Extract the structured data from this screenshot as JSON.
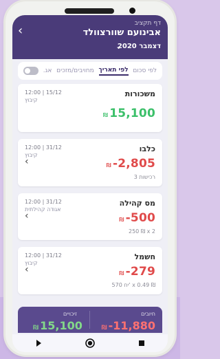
{
  "header": {
    "small": "דף תקציב",
    "title": "אבינועם שוורצוולד",
    "month": "דצמבר 2020",
    "back_icon": "chevron-left"
  },
  "tabs": {
    "items": [
      "לפי סכום",
      "לפי תאריך",
      "מחויבים/מזכים",
      "אג."
    ],
    "active_index": 1
  },
  "cards": [
    {
      "title": "משכורות",
      "time": "12:00 | 15/12",
      "sub": "קיבוץ",
      "amount_value": "15,100",
      "amount_currency": "₪",
      "amount_color": "#3cc06a",
      "extra": ""
    },
    {
      "title": "כלבו",
      "time": "12:00 | 31/12",
      "sub": "קיבוץ",
      "amount_value": "-2,805",
      "amount_currency": "₪",
      "amount_color": "#e04b4b",
      "extra": "3 רכישות"
    },
    {
      "title": "מס קהילה",
      "time": "12:00 | 31/12",
      "sub": "אגודה קהילתית",
      "amount_value": "-500",
      "amount_currency": "₪",
      "amount_color": "#e04b4b",
      "extra": "250 ₪ x 2"
    },
    {
      "title": "חשמל",
      "time": "12:00 | 31/12",
      "sub": "קיבוץ",
      "amount_value": "-279",
      "amount_currency": "₪",
      "amount_color": "#e04b4b",
      "extra": "570 יח' x 0.49 ₪"
    }
  ],
  "summary": {
    "left_label": "זיכויים",
    "left_amount": "15,100",
    "left_currency": "₪",
    "right_label": "חיובים",
    "right_amount": "-11,880",
    "right_currency": "₪"
  }
}
